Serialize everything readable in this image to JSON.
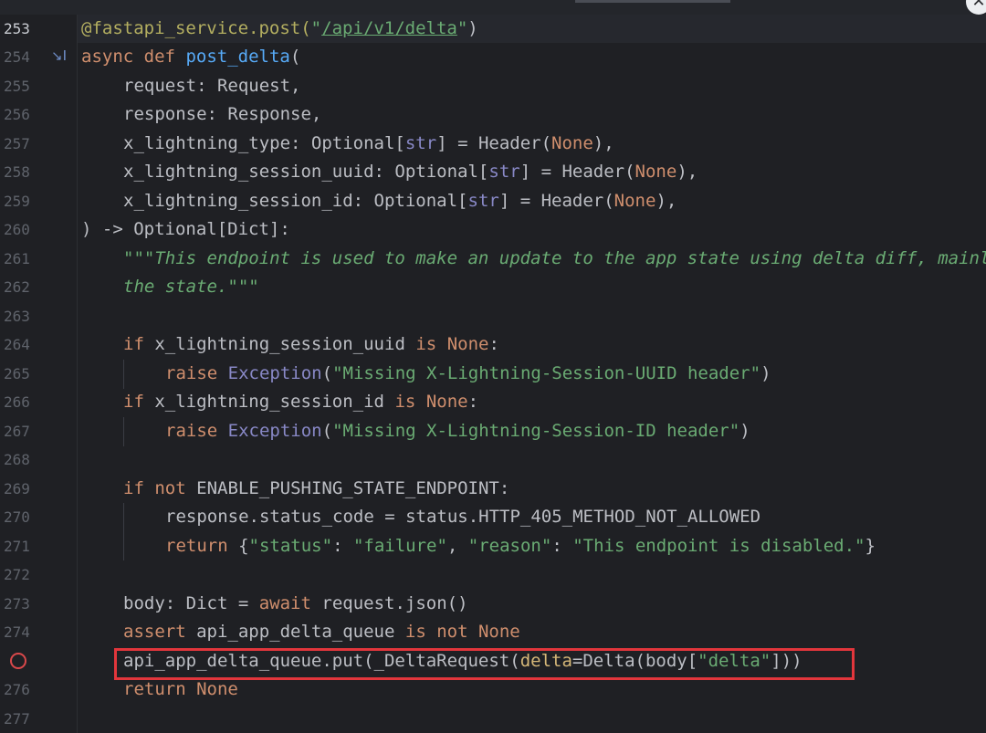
{
  "window": {
    "close_icon": "close-x-icon"
  },
  "gutter": {
    "line_numbers": [
      "253",
      "254",
      "255",
      "256",
      "257",
      "258",
      "259",
      "260",
      "261",
      "262",
      "263",
      "264",
      "265",
      "266",
      "267",
      "268",
      "269",
      "270",
      "271",
      "272",
      "273",
      "274",
      "",
      "276",
      "277"
    ],
    "implements_icon": "↘I",
    "breakpoint_line": "275"
  },
  "code": {
    "l253": {
      "decorator": "@fastapi_service.post(",
      "quote_open": "\"",
      "route": "/api/v1/delta",
      "quote_close": "\"",
      "close": ")"
    },
    "l254": {
      "async": "async",
      "def": "def",
      "name": "post_delta",
      "open": "("
    },
    "l255": "request: Request,",
    "l256": "response: Response,",
    "l257": {
      "a": "x_lightning_type: Optional[",
      "b": "str",
      "c": "] = Header(",
      "d": "None",
      "e": "),"
    },
    "l258": {
      "a": "x_lightning_session_uuid: Optional[",
      "b": "str",
      "c": "] = Header(",
      "d": "None",
      "e": "),"
    },
    "l259": {
      "a": "x_lightning_session_id: Optional[",
      "b": "str",
      "c": "] = Header(",
      "d": "None",
      "e": "),"
    },
    "l260": ") -> Optional[Dict]:",
    "l261": "\"\"\"This endpoint is used to make an update to the app state using delta diff, mainl",
    "l262": "the state.\"\"\"",
    "l264": {
      "if": "if",
      "var": "x_lightning_session_uuid",
      "is": "is",
      "none": "None",
      "colon": ":"
    },
    "l265": {
      "raise": "raise",
      "exc": "Exception",
      "open": "(",
      "msg": "\"Missing X-Lightning-Session-UUID header\"",
      "close": ")"
    },
    "l266": {
      "if": "if",
      "var": "x_lightning_session_id",
      "is": "is",
      "none": "None",
      "colon": ":"
    },
    "l267": {
      "raise": "raise",
      "exc": "Exception",
      "open": "(",
      "msg": "\"Missing X-Lightning-Session-ID header\"",
      "close": ")"
    },
    "l269": {
      "if": "if",
      "not": "not",
      "var": "ENABLE_PUSHING_STATE_ENDPOINT:"
    },
    "l270": "response.status_code = status.HTTP_405_METHOD_NOT_ALLOWED",
    "l271": {
      "ret": "return",
      "o": "{",
      "k1": "\"status\"",
      "c1": ": ",
      "v1": "\"failure\"",
      "sep": ", ",
      "k2": "\"reason\"",
      "c2": ": ",
      "v2": "\"This endpoint is disabled.\"",
      "cl": "}"
    },
    "l273": {
      "a": "body: Dict = ",
      "await": "await",
      "b": "request.json()"
    },
    "l274": {
      "assert": "assert",
      "var": "api_app_delta_queue",
      "isnot": "is not",
      "none": "None"
    },
    "l275": {
      "a": "api_app_delta_queue.put(_DeltaRequest(",
      "param": "delta",
      "b": "=Delta(body[",
      "key": "\"delta\"",
      "c": "]))"
    },
    "l276": {
      "ret": "return",
      "none": "None"
    }
  }
}
